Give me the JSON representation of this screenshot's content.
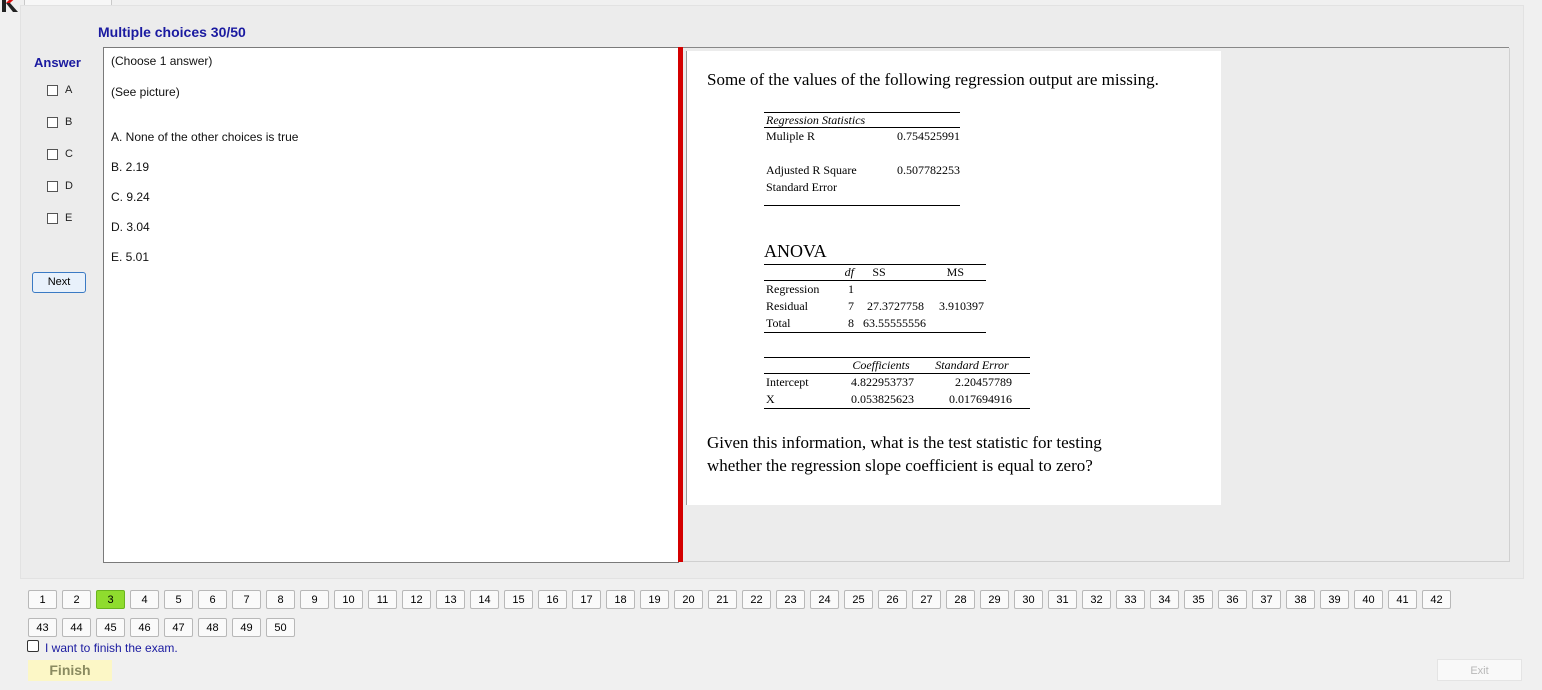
{
  "header": {
    "title": "Multiple choices 30/50"
  },
  "answer": {
    "label": "Answer",
    "options": [
      "A",
      "B",
      "C",
      "D",
      "E"
    ],
    "next_label": "Next"
  },
  "question": {
    "instruction": "(Choose 1 answer)",
    "see_picture": "(See picture)",
    "choices": [
      "A.  None of the other choices is true",
      "B.  2.19",
      "C.  9.24",
      "D.  3.04",
      "E.  5.01"
    ]
  },
  "picture": {
    "intro": "Some of the values of the following regression output are missing.",
    "reg_stats_title": "Regression Statistics",
    "reg_stats": [
      {
        "label": "Muliple R",
        "value": "0.754525991"
      },
      {
        "label": "",
        "value": ""
      },
      {
        "label": "Adjusted R Square",
        "value": "0.507782253"
      },
      {
        "label": "Standard Error",
        "value": ""
      }
    ],
    "anova_title": "ANOVA",
    "anova_headers": [
      "",
      "df",
      "SS",
      "MS"
    ],
    "anova_rows": [
      {
        "label": "Regression",
        "df": "1",
        "ss": "",
        "ms": ""
      },
      {
        "label": "Residual",
        "df": "7",
        "ss": "27.3727758",
        "ms": "3.910397"
      },
      {
        "label": "Total",
        "df": "8",
        "ss": "63.55555556",
        "ms": ""
      }
    ],
    "coef_headers": [
      "",
      "Coefficients",
      "Standard Error"
    ],
    "coef_rows": [
      {
        "label": "Intercept",
        "coef": "4.822953737",
        "se": "2.20457789"
      },
      {
        "label": "X",
        "coef": "0.053825623",
        "se": "0.017694916"
      }
    ],
    "question_line1": "Given this information, what is the test statistic for testing",
    "question_line2": "whether the regression  slope coefficient is equal to zero?"
  },
  "nav": {
    "row1": [
      "1",
      "2",
      "3",
      "4",
      "5",
      "6",
      "7",
      "8",
      "9",
      "10",
      "11",
      "12",
      "13",
      "14",
      "15",
      "16",
      "17",
      "18",
      "19",
      "20",
      "21",
      "22",
      "23",
      "24",
      "25",
      "26",
      "27",
      "28",
      "29",
      "30",
      "31",
      "32",
      "33",
      "34",
      "35",
      "36",
      "37",
      "38",
      "39",
      "40",
      "41",
      "42"
    ],
    "row2": [
      "43",
      "44",
      "45",
      "46",
      "47",
      "48",
      "49",
      "50"
    ],
    "active": "3",
    "active_color": "#8fdc2e"
  },
  "footer": {
    "finish_checkbox_label": "I want to finish the exam.",
    "finish_label": "Finish",
    "exit_label": "Exit"
  }
}
